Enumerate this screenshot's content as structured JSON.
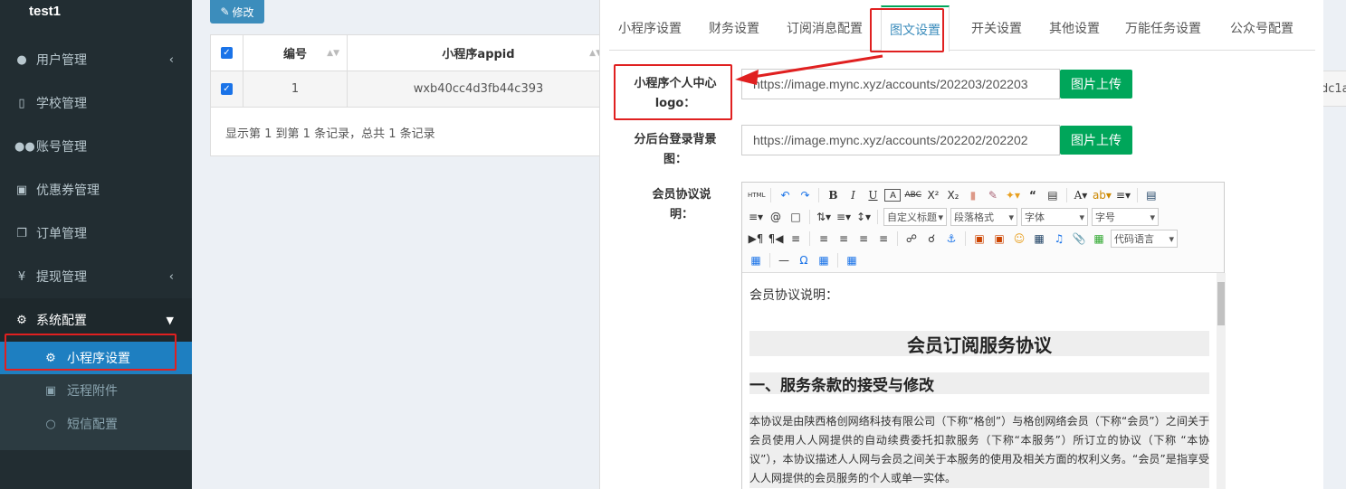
{
  "sidebar": {
    "username": "test1",
    "items": [
      {
        "label": "用户管理",
        "icon": "user-icon",
        "glyph": "👤",
        "arrow": "‹"
      },
      {
        "label": "学校管理",
        "icon": "book-icon",
        "glyph": "📘",
        "arrow": ""
      },
      {
        "label": "账号管理",
        "icon": "users-icon",
        "glyph": "👥",
        "arrow": ""
      },
      {
        "label": "优惠券管理",
        "icon": "money-icon",
        "glyph": "💵",
        "arrow": ""
      },
      {
        "label": "订单管理",
        "icon": "copy-icon",
        "glyph": "❐",
        "arrow": ""
      },
      {
        "label": "提现管理",
        "icon": "yen-icon",
        "glyph": "¥",
        "arrow": "‹"
      },
      {
        "label": "系统配置",
        "icon": "gear-icon",
        "glyph": "⚙",
        "arrow": "⌄"
      }
    ],
    "subitems": [
      {
        "label": "小程序设置",
        "icon": "gear-icon",
        "glyph": "⚙"
      },
      {
        "label": "远程附件",
        "icon": "image-icon",
        "glyph": "🖼"
      },
      {
        "label": "短信配置",
        "icon": "comment-icon",
        "glyph": "💬"
      }
    ]
  },
  "toolbar": {
    "edit_label": "修改"
  },
  "table": {
    "headers": [
      "编号",
      "小程序appid"
    ],
    "row": {
      "id": "1",
      "appid": "wxb40cc4d3fb44c393"
    },
    "footer": "显示第 1 到第 1 条记录，总共 1 条记录",
    "partial_cell": "dc1a"
  },
  "modal": {
    "tabs": [
      "小程序设置",
      "财务设置",
      "订阅消息配置",
      "图文设置",
      "开关设置",
      "其他设置",
      "万能任务设置",
      "公众号配置"
    ],
    "active_tab": "图文设置",
    "fields": [
      {
        "label": "小程序个人中心logo：",
        "value": "https://image.mync.xyz/accounts/202203/202203",
        "button": "图片上传"
      },
      {
        "label": "分后台登录背景图：",
        "value": "https://image.mync.xyz/accounts/202202/202202",
        "button": "图片上传"
      }
    ],
    "editor_label": "会员协议说明：",
    "editor": {
      "selects": [
        "自定义标题",
        "段落格式",
        "字体",
        "字号",
        "代码语言"
      ],
      "intro": "会员协议说明：",
      "title": "会员订阅服务协议",
      "section": "一、服务条款的接受与修改",
      "paragraph": "本协议是由陕西格创网络科技有限公司（下称“格创”）与格创网络会员（下称“会员”）之间关于会员使用人人网提供的自动续费委托扣款服务（下称“本服务”）所订立的协议（下称 “本协议”），本协议描述人人网与会员之间关于本服务的使用及相关方面的权利义务。“会员”是指享受人人网提供的会员服务的个人或单一实体。"
    }
  },
  "colors": {
    "sidebar_bg": "#222d32",
    "active_blue": "#1e7fc1",
    "green": "#00a65a",
    "annotation_red": "#e02020"
  }
}
